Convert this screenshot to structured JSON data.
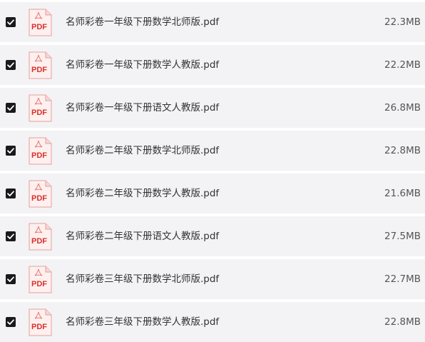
{
  "files": [
    {
      "checked": true,
      "icon": "pdf-file-icon",
      "icon_label": "PDF",
      "name": "名师彩卷一年级下册数学北师版.pdf",
      "size": "22.3MB"
    },
    {
      "checked": true,
      "icon": "pdf-file-icon",
      "icon_label": "PDF",
      "name": "名师彩卷一年级下册数学人教版.pdf",
      "size": "22.2MB"
    },
    {
      "checked": true,
      "icon": "pdf-file-icon",
      "icon_label": "PDF",
      "name": "名师彩卷一年级下册语文人教版.pdf",
      "size": "26.8MB"
    },
    {
      "checked": true,
      "icon": "pdf-file-icon",
      "icon_label": "PDF",
      "name": "名师彩卷二年级下册数学北师版.pdf",
      "size": "22.8MB"
    },
    {
      "checked": true,
      "icon": "pdf-file-icon",
      "icon_label": "PDF",
      "name": "名师彩卷二年级下册数学人教版.pdf",
      "size": "21.6MB"
    },
    {
      "checked": true,
      "icon": "pdf-file-icon",
      "icon_label": "PDF",
      "name": "名师彩卷二年级下册语文人教版.pdf",
      "size": "27.5MB"
    },
    {
      "checked": true,
      "icon": "pdf-file-icon",
      "icon_label": "PDF",
      "name": "名师彩卷三年级下册数学北师版.pdf",
      "size": "22.7MB"
    },
    {
      "checked": true,
      "icon": "pdf-file-icon",
      "icon_label": "PDF",
      "name": "名师彩卷三年级下册数学人教版.pdf",
      "size": "22.8MB"
    }
  ],
  "colors": {
    "row_background": "#f3f3f5",
    "checkbox": "#1a1a1a",
    "pdf_red": "#d9302a",
    "text": "#333333"
  }
}
